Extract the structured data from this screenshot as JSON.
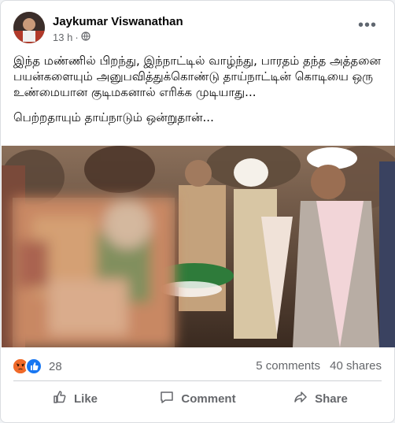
{
  "post": {
    "author": "Jaykumar Viswanathan",
    "time": "13 h",
    "audience_icon": "globe-icon",
    "paragraph1": "இந்த மண்ணில் பிறந்து, இந்நாட்டில் வாழ்ந்து, பாரதம் தந்த அத்தனை பயன்களையும் அனுபவித்துக்கொண்டு தாய்நாட்டின் கொடியை ஒரு உண்மையான குடிமகனால் எரிக்க முடியாது...",
    "paragraph2": "பெற்றதாயும் தாய்நாடும் ஒன்றுதான்..."
  },
  "engagement": {
    "reaction_count": "28",
    "comments": "5 comments",
    "shares": "40 shares",
    "reaction_icons": [
      "angry-icon",
      "like-icon"
    ]
  },
  "actions": {
    "like": "Like",
    "comment": "Comment",
    "share": "Share"
  },
  "colors": {
    "brand_blue": "#1877f2",
    "angry": "#e9710f",
    "text_secondary": "#65676b"
  }
}
